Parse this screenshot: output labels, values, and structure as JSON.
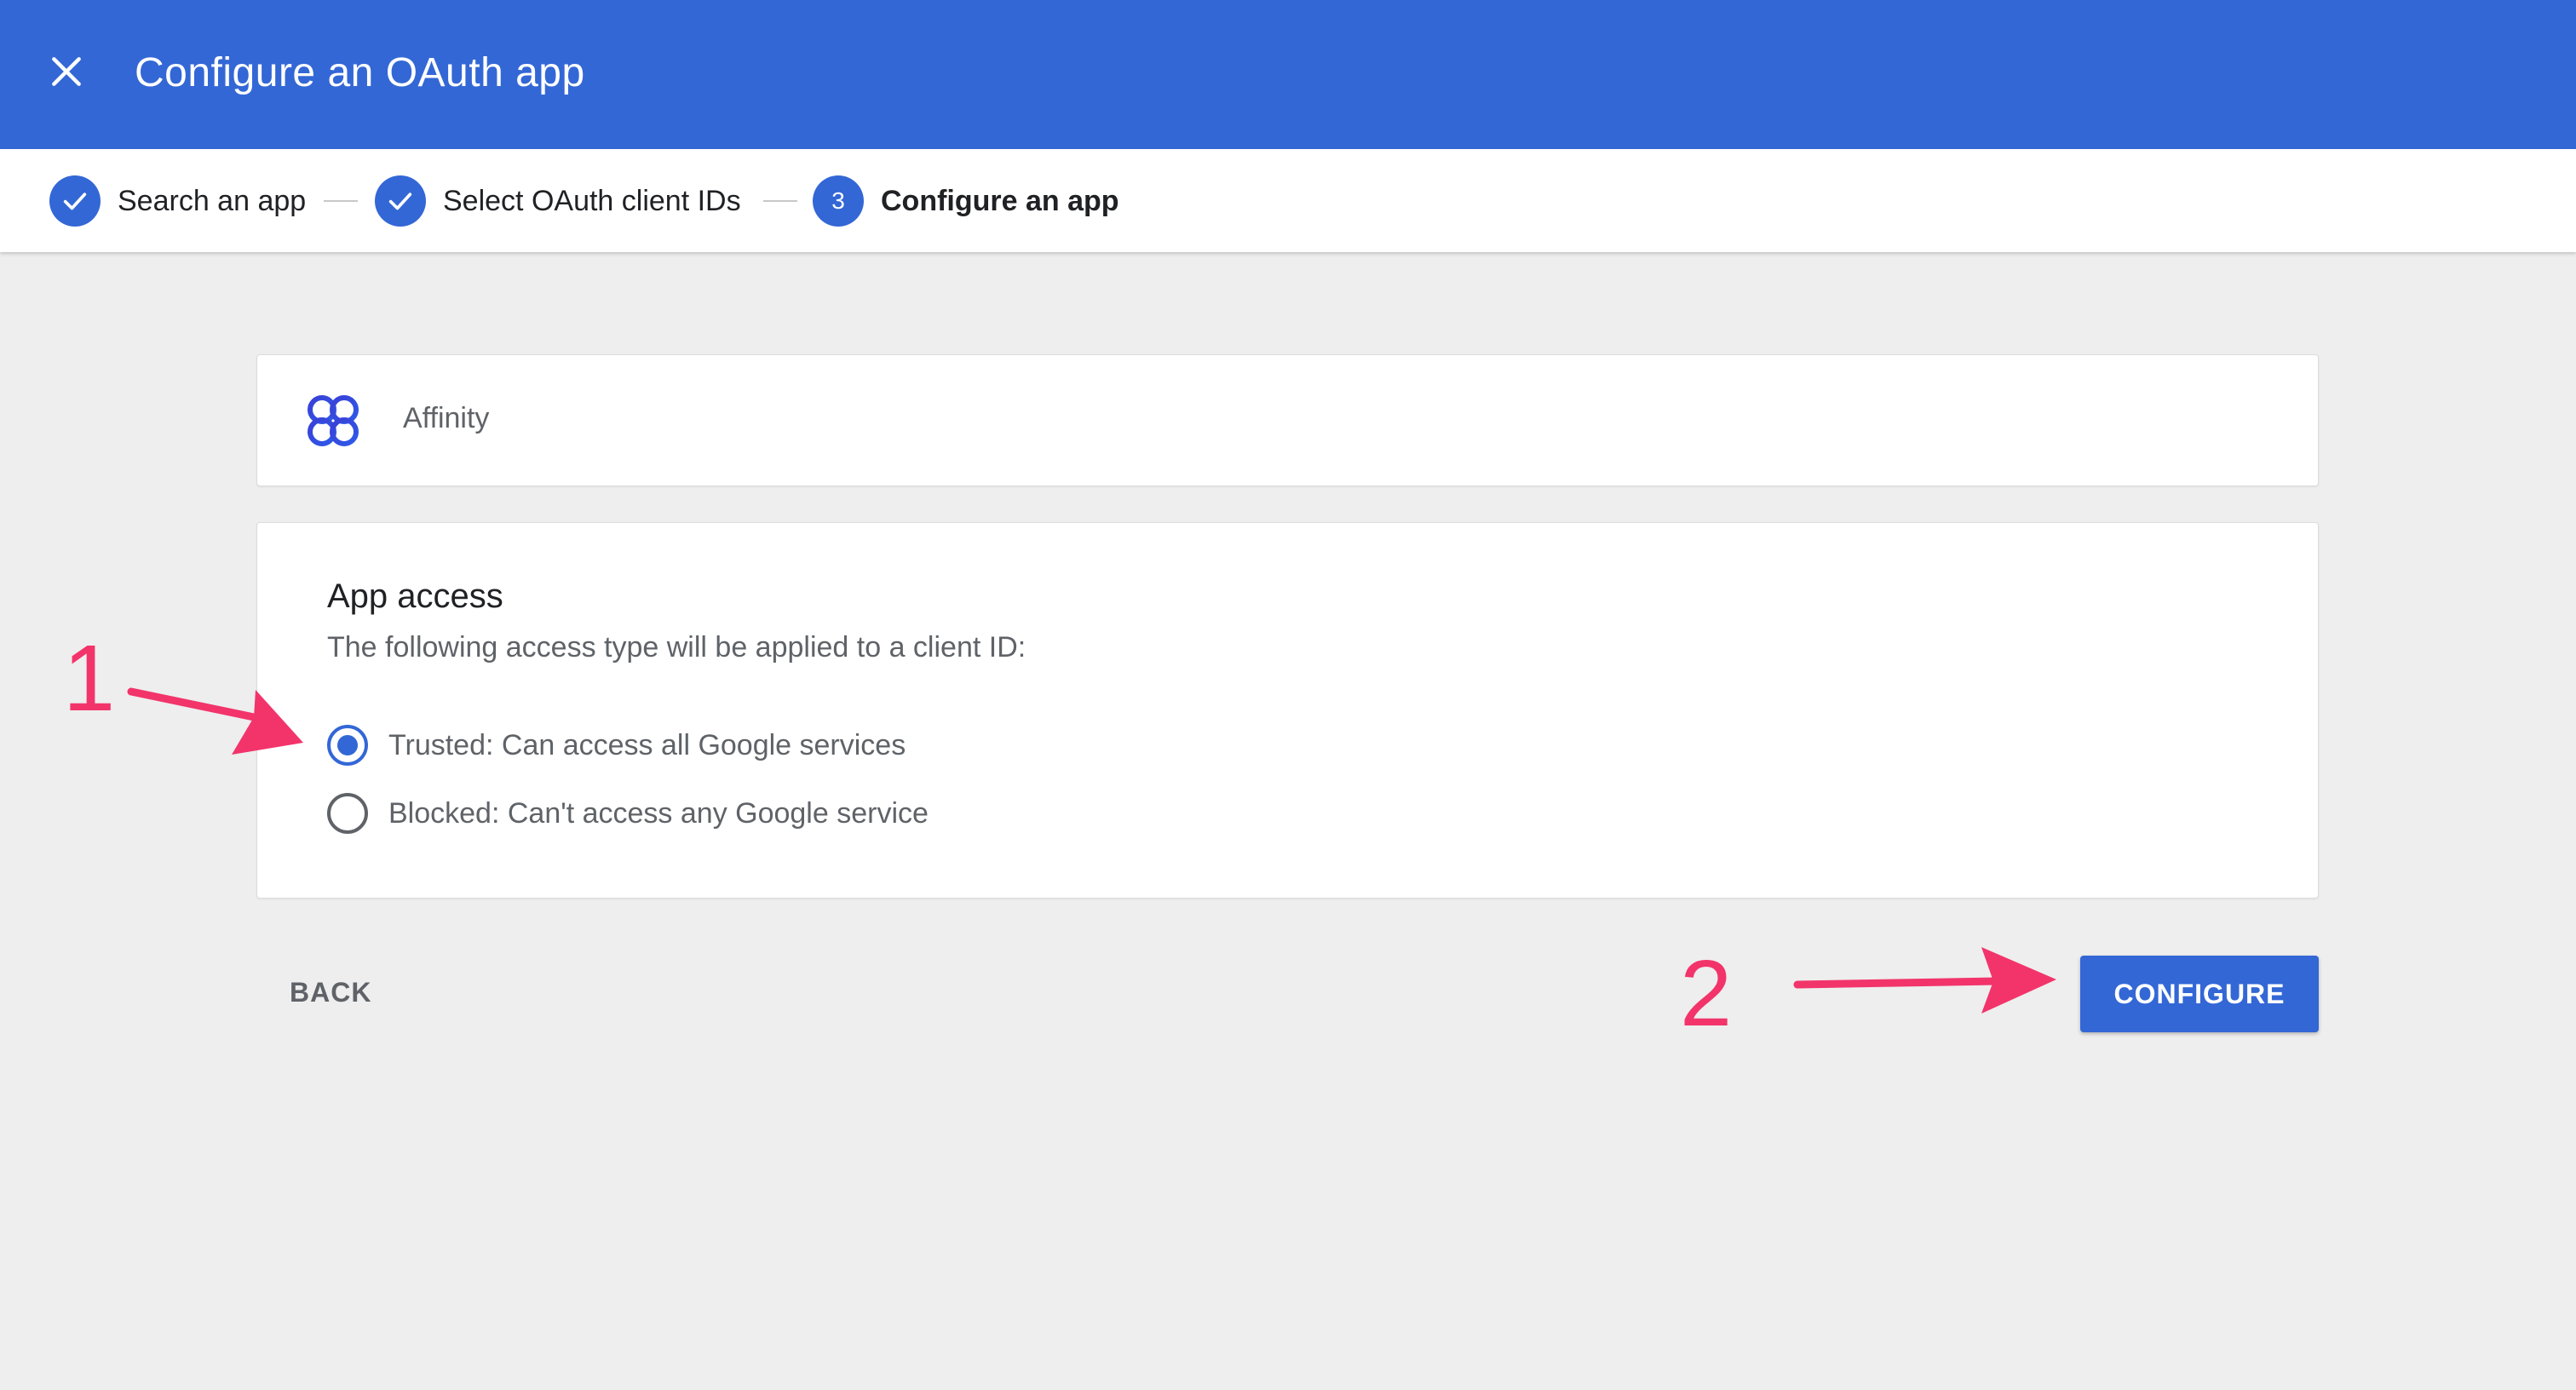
{
  "header": {
    "title": "Configure an OAuth app",
    "close_icon": "close-icon",
    "background_color": "#3367d6"
  },
  "stepper": {
    "steps": [
      {
        "label": "Search an app",
        "state": "completed",
        "icon": "check-icon"
      },
      {
        "label": "Select OAuth client IDs",
        "state": "completed",
        "icon": "check-icon"
      },
      {
        "label": "Configure an app",
        "state": "active",
        "number": "3"
      }
    ]
  },
  "app": {
    "name": "Affinity",
    "logo_icon": "affinity-logo-icon"
  },
  "access": {
    "title": "App access",
    "description": "The following access type will be applied to a client ID:",
    "options": [
      {
        "label": "Trusted: Can access all Google services",
        "checked": true
      },
      {
        "label": "Blocked: Can't access any Google service",
        "checked": false
      }
    ]
  },
  "actions": {
    "back_label": "BACK",
    "configure_label": "CONFIGURE"
  },
  "annotations": {
    "number_1": "1",
    "number_2": "2",
    "color": "#f2346b"
  }
}
